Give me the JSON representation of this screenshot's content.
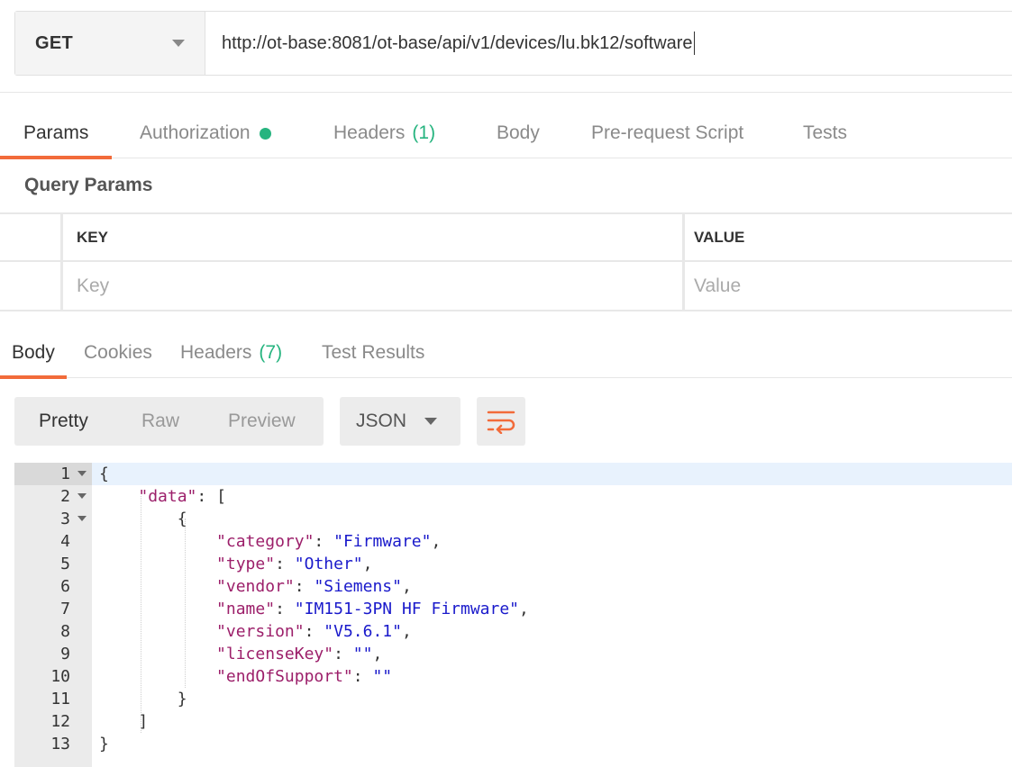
{
  "request": {
    "method": "GET",
    "url": "http://ot-base:8081/ot-base/api/v1/devices/lu.bk12/software"
  },
  "request_tabs": [
    {
      "label": "Params"
    },
    {
      "label": "Authorization"
    },
    {
      "label": "Headers",
      "count": "(1)"
    },
    {
      "label": "Body"
    },
    {
      "label": "Pre-request Script"
    },
    {
      "label": "Tests"
    }
  ],
  "query_params": {
    "title": "Query Params",
    "headers": {
      "key": "KEY",
      "value": "VALUE"
    },
    "placeholders": {
      "key": "Key",
      "value": "Value"
    }
  },
  "response_tabs": [
    {
      "label": "Body"
    },
    {
      "label": "Cookies"
    },
    {
      "label": "Headers",
      "count": "(7)"
    },
    {
      "label": "Test Results"
    }
  ],
  "response_view": {
    "options": [
      "Pretty",
      "Raw",
      "Preview"
    ],
    "format": "JSON"
  },
  "code": {
    "line_numbers": [
      "1",
      "2",
      "3",
      "4",
      "5",
      "6",
      "7",
      "8",
      "9",
      "10",
      "11",
      "12",
      "13"
    ],
    "lines": [
      "{",
      "    \"data\": [",
      "        {",
      "            \"category\": \"Firmware\",",
      "            \"type\": \"Other\",",
      "            \"vendor\": \"Siemens\",",
      "            \"name\": \"IM151-3PN HF Firmware\",",
      "            \"version\": \"V5.6.1\",",
      "            \"licenseKey\": \"\",",
      "            \"endOfSupport\": \"\"",
      "        }",
      "    ]",
      "}"
    ]
  },
  "colors": {
    "accent": "#f26b3a",
    "status_green": "#26b47f",
    "json_key": "#9c1f6a",
    "json_string": "#1a1acb"
  }
}
